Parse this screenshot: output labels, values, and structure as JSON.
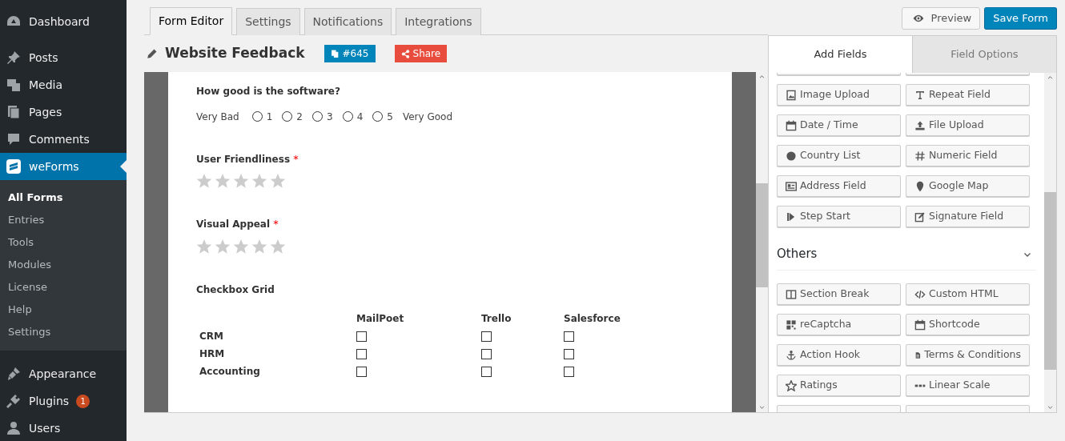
{
  "sidebar": {
    "items": [
      {
        "label": "Dashboard",
        "selected": false
      },
      {
        "label": "Posts",
        "selected": false
      },
      {
        "label": "Media",
        "selected": false
      },
      {
        "label": "Pages",
        "selected": false
      },
      {
        "label": "Comments",
        "selected": false
      },
      {
        "label": "weForms",
        "selected": true,
        "children": [
          {
            "label": "All Forms",
            "selected": true
          },
          {
            "label": "Entries",
            "selected": false
          },
          {
            "label": "Tools",
            "selected": false
          },
          {
            "label": "Modules",
            "selected": false
          },
          {
            "label": "License",
            "selected": false
          },
          {
            "label": "Help",
            "selected": false
          },
          {
            "label": "Settings",
            "selected": false
          }
        ]
      },
      {
        "label": "Appearance",
        "selected": false
      },
      {
        "label": "Plugins",
        "selected": false,
        "badge": "1"
      },
      {
        "label": "Users",
        "selected": false
      }
    ]
  },
  "editor_tabs": [
    {
      "label": "Form Editor",
      "selected": true
    },
    {
      "label": "Settings",
      "selected": false
    },
    {
      "label": "Notifications",
      "selected": false
    },
    {
      "label": "Integrations",
      "selected": false
    }
  ],
  "header_buttons": [
    {
      "label": "Preview",
      "kind": "preview"
    },
    {
      "label": "Save Form",
      "kind": "save"
    }
  ],
  "form": {
    "title": "Website Feedback",
    "id_badge": "#645",
    "share_button": "Share",
    "fields": [
      {
        "kind": "scale",
        "label": "How good is the software?",
        "low_label": "Very Bad",
        "high_label": "Very Good",
        "options": [
          {
            "label": "1",
            "selected": false
          },
          {
            "label": "2",
            "selected": false
          },
          {
            "label": "3",
            "selected": false
          },
          {
            "label": "4",
            "selected": false
          },
          {
            "label": "5",
            "selected": false
          }
        ]
      },
      {
        "kind": "rating",
        "label": "User Friendliness",
        "required_mark": "*",
        "stars": 0
      },
      {
        "kind": "rating",
        "label": "Visual Appeal",
        "required_mark": "*",
        "stars": 0
      },
      {
        "kind": "grid",
        "label": "Checkbox Grid",
        "columns": [
          "MailPoet",
          "Trello",
          "Salesforce"
        ],
        "rows": [
          {
            "label": "CRM",
            "cells": [
              {
                "checked": false
              },
              {
                "checked": false
              },
              {
                "checked": false
              }
            ]
          },
          {
            "label": "HRM",
            "cells": [
              {
                "checked": false
              },
              {
                "checked": false
              },
              {
                "checked": false
              }
            ]
          },
          {
            "label": "Accounting",
            "cells": [
              {
                "checked": false
              },
              {
                "checked": false
              },
              {
                "checked": false
              }
            ]
          }
        ]
      }
    ]
  },
  "panel": {
    "tabs": [
      {
        "label": "Add Fields",
        "selected": true
      },
      {
        "label": "Field Options",
        "selected": false
      }
    ],
    "field_buttons": [
      "Image Upload",
      "Repeat Field",
      "Date / Time",
      "File Upload",
      "Country List",
      "Numeric Field",
      "Address Field",
      "Google Map",
      "Step Start",
      "Signature Field"
    ],
    "sections": [
      {
        "title": "Others",
        "expanded": true,
        "buttons": [
          "Section Break",
          "Custom HTML",
          "reCaptcha",
          "Shortcode",
          "Action Hook",
          "Terms & Conditions",
          "Ratings",
          "Linear Scale"
        ]
      }
    ]
  }
}
